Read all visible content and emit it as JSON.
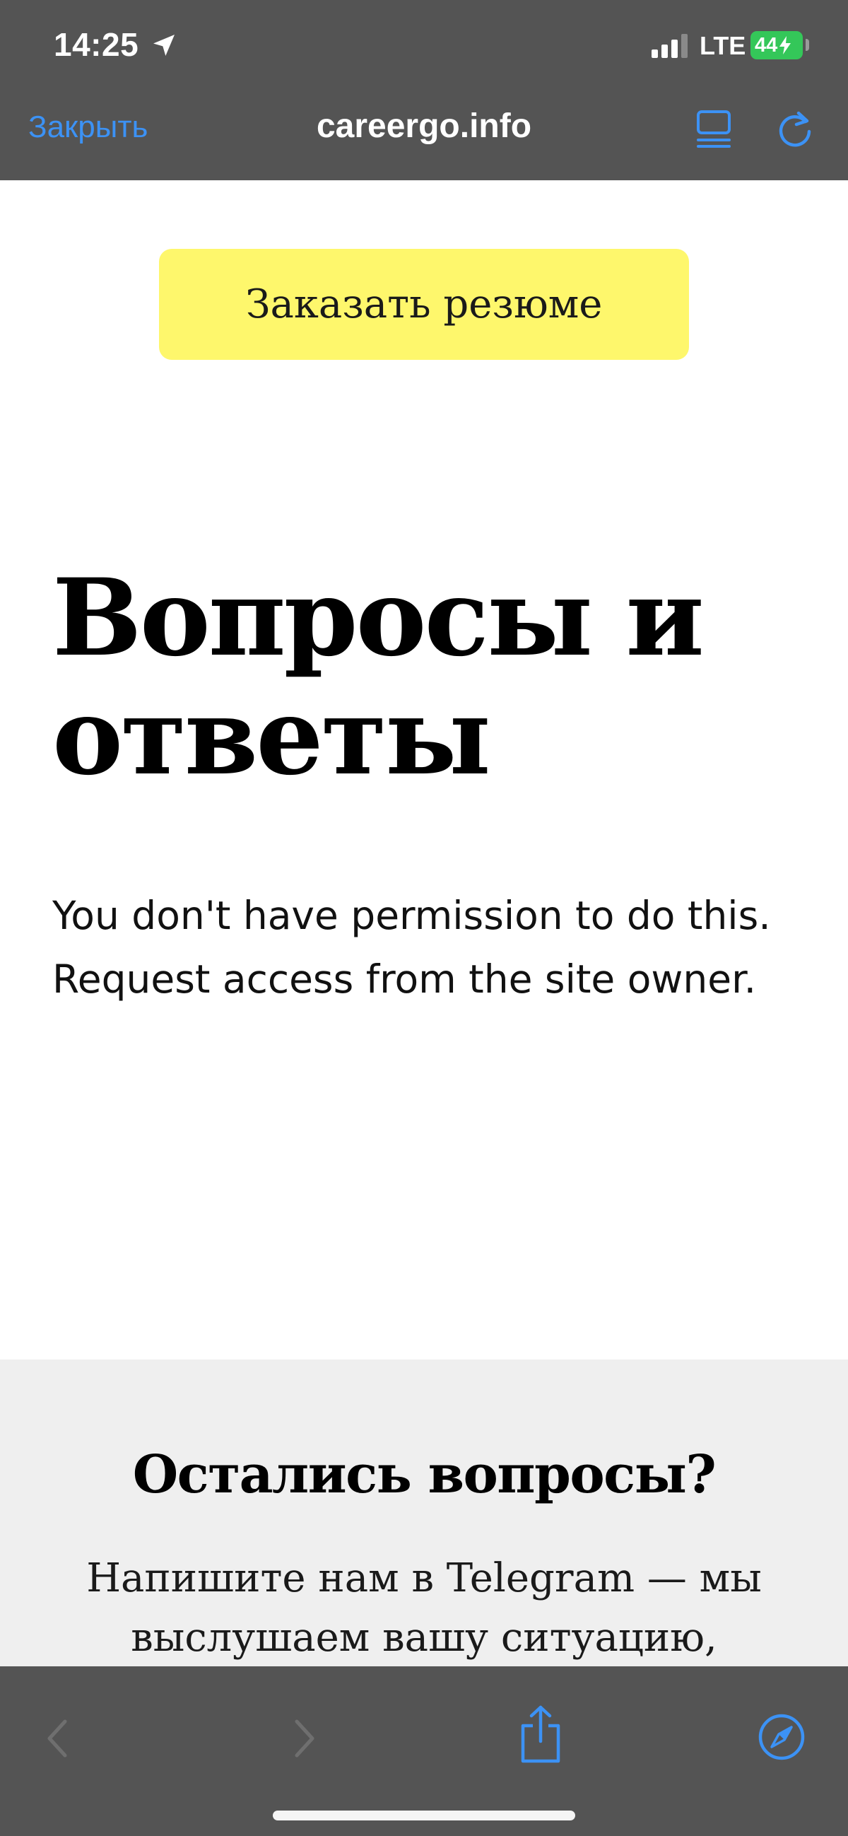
{
  "status_bar": {
    "time": "14:25",
    "network": "LTE",
    "battery_level": "44",
    "icons": [
      "location-arrow-icon",
      "cellular-signal-icon",
      "battery-charging-icon"
    ]
  },
  "browser": {
    "close_label": "Закрыть",
    "domain": "careergo.info",
    "accent_color": "#3c92f5",
    "toolbar_color": "#545454",
    "icons": [
      "reader-view-icon",
      "reload-icon"
    ]
  },
  "page": {
    "order_button_label": "Заказать резюме",
    "order_button_color": "#fef76c",
    "faq_title": "Вопросы и ответы",
    "permission_message": "You don't have permission to do this. Request access from the site owner.",
    "questions_section": {
      "title": "Остались вопросы?",
      "text": "Напишите нам в Telegram — мы выслушаем вашу ситуацию,",
      "background_color": "#efefef"
    }
  },
  "bottom_toolbar": {
    "icons": [
      "back-chevron-icon",
      "forward-chevron-icon",
      "share-icon",
      "compass-icon"
    ]
  }
}
